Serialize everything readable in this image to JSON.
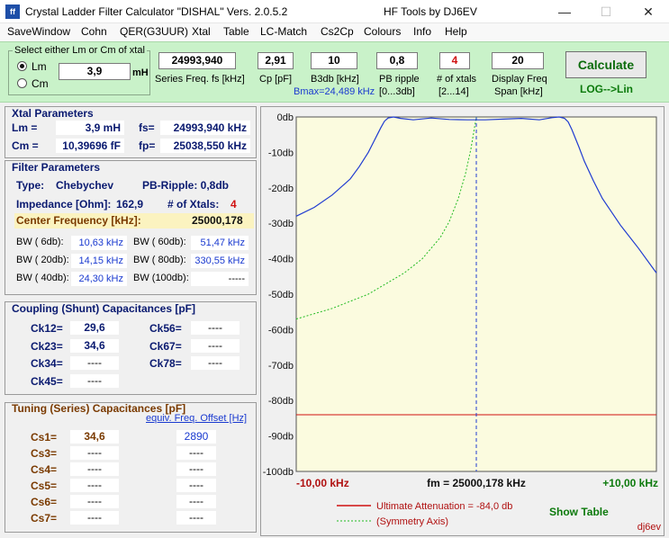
{
  "window": {
    "title": "Crystal Ladder Filter Calculator  \"DISHAL\"  Vers. 2.0.5.2",
    "title_right": "HF Tools by DJ6EV",
    "icon_label": "ff",
    "min_glyph": "—",
    "max_glyph": "☐",
    "close_glyph": "✕"
  },
  "menu": [
    "SaveWindow",
    "Cohn",
    "QER(G3UUR)",
    "Xtal",
    "Table",
    "LC-Match",
    "Cs2Cp",
    "Colours",
    "Info",
    "Help"
  ],
  "top": {
    "select_group_title": "Select either Lm or Cm of xtal",
    "radio_lm": "Lm",
    "radio_cm": "Cm",
    "selected": "Lm",
    "lm_value": "3,9",
    "lm_unit": "mH",
    "series_freq": "24993,940",
    "series_freq_label": "Series Freq. fs [kHz]",
    "cp": "2,91",
    "cp_label": "Cp [pF]",
    "b3db": "10",
    "b3db_label": "B3db [kHz]",
    "bmax_label": "Bmax=24,489 kHz",
    "pb_ripple": "0,8",
    "pb_ripple_label1": "PB ripple",
    "pb_ripple_label2": "[0...3db]",
    "n_xtals": "4",
    "n_xtals_label1": "# of xtals",
    "n_xtals_label2": "[2...14]",
    "display_span": "20",
    "display_span_label1": "Display Freq",
    "display_span_label2": "Span [kHz]",
    "calc_label": "Calculate",
    "log_lin_label": "LOG-->Lin"
  },
  "xtal_params": {
    "title": "Xtal Parameters",
    "lm_label": "Lm =",
    "lm_value": "3,9 mH",
    "fs_label": "fs=",
    "fs_value": "24993,940 kHz",
    "cm_label": "Cm =",
    "cm_value": "10,39696  fF",
    "fp_label": "fp=",
    "fp_value": "25038,550 kHz"
  },
  "filter_params": {
    "title": "Filter Parameters",
    "type_label": "Type:",
    "type_value": "Chebychev",
    "pb_ripple": "PB-Ripple: 0,8db",
    "impedance_label": "Impedance [Ohm]:",
    "impedance_value": "162,9",
    "nxtals_label": "# of Xtals:",
    "nxtals_value": "4",
    "center_label": "Center Frequency [kHz]:",
    "center_value": "25000,178",
    "bw": [
      {
        "label": "BW (  6db):",
        "value": "10,63 kHz"
      },
      {
        "label": "BW ( 60db):",
        "value": "51,47 kHz"
      },
      {
        "label": "BW ( 20db):",
        "value": "14,15 kHz"
      },
      {
        "label": "BW ( 80db):",
        "value": "330,55 kHz"
      },
      {
        "label": "BW ( 40db):",
        "value": "24,30 kHz"
      },
      {
        "label": "BW (100db):",
        "value": "-----"
      }
    ]
  },
  "coupling": {
    "title": "Coupling (Shunt) Capacitances [pF]",
    "items": [
      {
        "label": "Ck12=",
        "value": "29,6"
      },
      {
        "label": "Ck56=",
        "value": "----"
      },
      {
        "label": "Ck23=",
        "value": "34,6"
      },
      {
        "label": "Ck67=",
        "value": "----"
      },
      {
        "label": "Ck34=",
        "value": "----"
      },
      {
        "label": "Ck78=",
        "value": "----"
      },
      {
        "label": "Ck45=",
        "value": "----"
      }
    ]
  },
  "tuning": {
    "title": "Tuning (Series) Capacitances [pF]",
    "offset_label": "equiv. Freq. Offset [Hz]",
    "items": [
      {
        "label": "Cs1=",
        "value": "34,6",
        "offset": "2890"
      },
      {
        "label": "Cs3=",
        "value": "----",
        "offset": "----"
      },
      {
        "label": "Cs4=",
        "value": "----",
        "offset": "----"
      },
      {
        "label": "Cs5=",
        "value": "----",
        "offset": "----"
      },
      {
        "label": "Cs6=",
        "value": "----",
        "offset": "----"
      },
      {
        "label": "Cs7=",
        "value": "----",
        "offset": "----"
      }
    ]
  },
  "chart": {
    "x_left_label": "-10,00 kHz",
    "x_center_label": "fm = 25000,178 kHz",
    "x_right_label": "+10,00 kHz",
    "legend_attenuation": "Ultimate Attenuation =  -84,0 db",
    "legend_symmetry": "(Symmetry Axis)",
    "show_table": "Show Table",
    "signature": "dj6ev",
    "colors": {
      "response": "#1f3bd1",
      "attenuation": "#d01010",
      "symmetry": "#22bb22",
      "background": "#fbfbdf"
    }
  },
  "chart_data": {
    "type": "line",
    "xlim": [
      -10,
      10
    ],
    "ylim": [
      -100,
      0
    ],
    "y_ticks": [
      "0db",
      "-10db",
      "-20db",
      "-30db",
      "-40db",
      "-50db",
      "-60db",
      "-70db",
      "-80db",
      "-90db",
      "-100db"
    ],
    "series": [
      {
        "name": "response",
        "x": [
          -10,
          -9,
          -8,
          -7,
          -6.5,
          -6,
          -5.7,
          -5.5,
          -5.3,
          -5.1,
          -4.9,
          -4.6,
          -4.2,
          -3.5,
          -2.5,
          -1.5,
          -0.5,
          0.5,
          1.5,
          2.5,
          3.5,
          4.2,
          4.6,
          4.9,
          5.1,
          5.3,
          5.5,
          5.7,
          6,
          6.5,
          7,
          8,
          9,
          10
        ],
        "y": [
          -28,
          -25.5,
          -22,
          -17.5,
          -14,
          -10,
          -7,
          -5,
          -3,
          -1.2,
          -0.3,
          0,
          -0.4,
          -0.8,
          -0.3,
          -0.7,
          -0.8,
          -0.8,
          -0.6,
          -0.4,
          -0.8,
          -0.2,
          0,
          -0.4,
          -1.4,
          -3.5,
          -6,
          -8.5,
          -12.5,
          -18,
          -23,
          -30.5,
          -37,
          -44
        ]
      },
      {
        "name": "symmetry",
        "x": [
          -10,
          -8,
          -6,
          -4,
          -3,
          -2,
          -1.5,
          -1,
          -0.6,
          -0.3,
          -0.1,
          0
        ],
        "y": [
          -57,
          -54,
          -50,
          -44,
          -40,
          -34,
          -29.5,
          -23,
          -16,
          -9,
          -3,
          0
        ]
      }
    ],
    "ultimate_attenuation": -84.0,
    "symmetry_axis_x": 0,
    "grid": false
  }
}
